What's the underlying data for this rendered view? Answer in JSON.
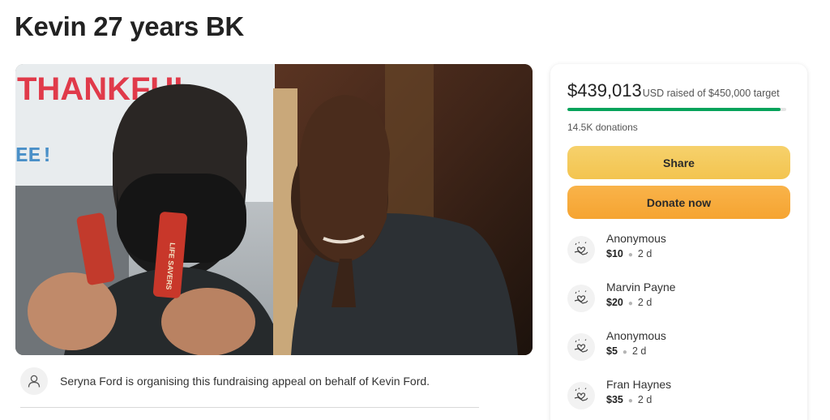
{
  "page": {
    "title": "Kevin 27 years BK"
  },
  "campaign": {
    "raised_amount": "$439,013",
    "raised_rest": "USD raised of $450,000 target",
    "progress_fraction": 0.9756,
    "donations_count": "14.5K donations",
    "share_label": "Share",
    "donate_label": "Donate now"
  },
  "donors": [
    {
      "name": "Anonymous",
      "amount": "$10",
      "time": "2 d"
    },
    {
      "name": "Marvin Payne",
      "amount": "$20",
      "time": "2 d"
    },
    {
      "name": "Anonymous",
      "amount": "$5",
      "time": "2 d"
    },
    {
      "name": "Fran Haynes",
      "amount": "$35",
      "time": "2 d"
    }
  ],
  "organiser": {
    "text": "Seryna Ford is organising this fundraising appeal on behalf of Kevin Ford."
  },
  "photo": {
    "sign_text": "THANKFUL",
    "sign_text_small": "EE!",
    "candy_label": "LIFE SAVERS"
  },
  "colors": {
    "progress": "#06a35b",
    "share": "#f3c44f",
    "donate": "#f5a431"
  }
}
